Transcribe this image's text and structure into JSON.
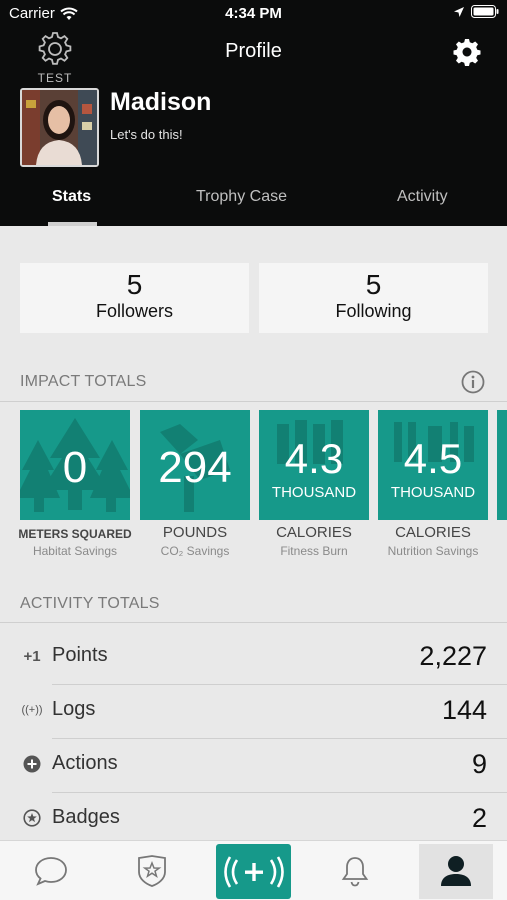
{
  "status_bar": {
    "carrier": "Carrier",
    "time": "4:34 PM"
  },
  "header": {
    "test_label": "TEST",
    "title": "Profile"
  },
  "profile": {
    "name": "Madison",
    "tagline": "Let's do this!"
  },
  "tabs": [
    {
      "label": "Stats",
      "active": true
    },
    {
      "label": "Trophy Case",
      "active": false
    },
    {
      "label": "Activity",
      "active": false
    }
  ],
  "social": {
    "followers": {
      "count": "5",
      "label": "Followers"
    },
    "following": {
      "count": "5",
      "label": "Following"
    }
  },
  "impact": {
    "heading": "IMPACT TOTALS",
    "tiles": [
      {
        "value": "0",
        "unit": "",
        "caption": "METERS SQUARED",
        "sub": "Habitat Savings",
        "icon": "tree-icon"
      },
      {
        "value": "294",
        "unit": "",
        "caption": "POUNDS",
        "sub": "CO₂ Savings",
        "icon": "cloud-icon"
      },
      {
        "value": "4.3",
        "unit": "THOUSAND",
        "caption": "CALORIES",
        "sub": "Fitness Burn",
        "icon": "runner-icon"
      },
      {
        "value": "4.5",
        "unit": "THOUSAND",
        "caption": "CALORIES",
        "sub": "Nutrition Savings",
        "icon": "food-icon"
      }
    ]
  },
  "activity": {
    "heading": "ACTIVITY TOTALS",
    "rows": [
      {
        "label": "Points",
        "value": "2,227",
        "icon": "plus-one-icon",
        "icon_text": "+1"
      },
      {
        "label": "Logs",
        "value": "144",
        "icon": "broadcast-plus-icon",
        "icon_text": "((+))"
      },
      {
        "label": "Actions",
        "value": "9",
        "icon": "plus-circle-icon",
        "icon_text": ""
      },
      {
        "label": "Badges",
        "value": "2",
        "icon": "star-circle-icon",
        "icon_text": ""
      }
    ]
  },
  "nav": [
    {
      "name": "chat-icon"
    },
    {
      "name": "badge-shield-icon"
    },
    {
      "name": "log-action-icon",
      "text": "((+))"
    },
    {
      "name": "bell-icon"
    },
    {
      "name": "profile-icon",
      "active": true
    }
  ],
  "colors": {
    "accent": "#16998a",
    "header_bg": "#0b0c0c",
    "page_bg": "#e9e9e9"
  }
}
